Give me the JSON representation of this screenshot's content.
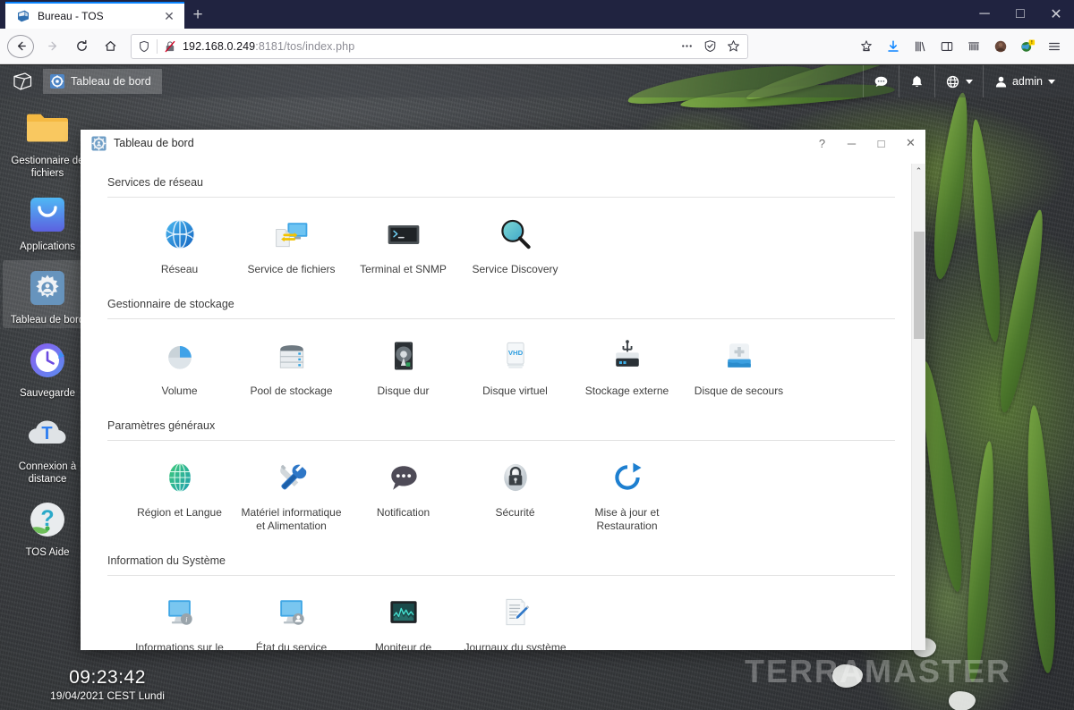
{
  "browser": {
    "tab": {
      "title": "Bureau - TOS",
      "favicon_icon": "tos-cube-icon",
      "close_icon": "close-icon"
    },
    "new_tab_label": "+",
    "nav": {
      "back_icon": "back-arrow-icon",
      "forward_icon": "forward-arrow-icon",
      "reload_icon": "reload-icon",
      "home_icon": "home-icon"
    },
    "url": {
      "shield_icon": "shield-icon",
      "insecure_icon": "insecure-lock-strikethrough-icon",
      "host": "192.168.0.249",
      "path": ":8181/tos/index.php",
      "full": "192.168.0.249:8181/tos/index.php",
      "page_actions_icon": "ellipsis-icon",
      "reader_icon": "reader-view-icon",
      "bookmark_icon": "star-icon"
    },
    "toolbar_icons": [
      "save-to-pocket-icon",
      "downloads-icon",
      "library-icon",
      "sidebars-icon",
      "containers-icon",
      "account-avatar-icon",
      "extension-globe-icon",
      "app-menu-icon"
    ],
    "extension_badge": "!",
    "window_controls": {
      "minimize": "─",
      "maximize": "□",
      "close": "✕"
    }
  },
  "tos_topbar": {
    "logo_icon": "terramaster-cube-logo-icon",
    "task_item": {
      "icon": "dashboard-gear-icon",
      "label": "Tableau de bord"
    },
    "right": [
      {
        "name": "chat-icon",
        "label": ""
      },
      {
        "name": "notification-bell-icon",
        "label": ""
      },
      {
        "name": "language-globe-icon",
        "label": ""
      }
    ],
    "user": {
      "icon": "user-icon",
      "label": "admin"
    }
  },
  "desktop": {
    "icons": [
      {
        "name": "file-manager",
        "icon": "folder-icon",
        "label": "Gestionnaire de fichiers"
      },
      {
        "name": "applications",
        "icon": "app-store-bag-icon",
        "label": "Applications"
      },
      {
        "name": "dashboard",
        "icon": "dashboard-gear-icon",
        "label": "Tableau de bord"
      },
      {
        "name": "backup",
        "icon": "clock-backup-icon",
        "label": "Sauvegarde"
      },
      {
        "name": "remote-connection",
        "icon": "cloud-t-icon",
        "label": "Connexion à distance"
      },
      {
        "name": "tos-help",
        "icon": "question-mark-icon",
        "label": "TOS Aide"
      }
    ],
    "clock": {
      "time": "09:23:42",
      "date": "19/04/2021 CEST Lundi"
    },
    "watermark": "TERRAMASTER"
  },
  "dashboard_window": {
    "title": "Tableau de bord",
    "title_icon": "dashboard-gear-icon",
    "controls": {
      "help": "?",
      "minimize": "─",
      "maximize": "□",
      "close": "✕"
    },
    "scrollbar": {
      "up_arrow": "⌃"
    },
    "sections": [
      {
        "name": "services-de-reseau",
        "heading": "Services de réseau",
        "tiles": [
          {
            "name": "reseau",
            "icon": "globe-network-icon",
            "label": "Réseau"
          },
          {
            "name": "service-de-fichiers",
            "icon": "file-service-icon",
            "label": "Service de fichiers"
          },
          {
            "name": "terminal-et-snmp",
            "icon": "terminal-icon",
            "label": "Terminal et SNMP"
          },
          {
            "name": "service-discovery",
            "icon": "magnifier-icon",
            "label": "Service Discovery"
          }
        ]
      },
      {
        "name": "gestionnaire-de-stockage",
        "heading": "Gestionnaire de stockage",
        "tiles": [
          {
            "name": "volume",
            "icon": "pie-volume-icon",
            "label": "Volume"
          },
          {
            "name": "pool-de-stockage",
            "icon": "storage-pool-icon",
            "label": "Pool de stockage"
          },
          {
            "name": "disque-dur",
            "icon": "hard-disk-icon",
            "label": "Disque dur"
          },
          {
            "name": "disque-virtuel",
            "icon": "vhd-icon",
            "label": "Disque virtuel"
          },
          {
            "name": "stockage-externe",
            "icon": "usb-storage-icon",
            "label": "Stockage externe"
          },
          {
            "name": "disque-de-secours",
            "icon": "spare-disk-icon",
            "label": "Disque de secours"
          }
        ]
      },
      {
        "name": "parametres-generaux",
        "heading": "Paramètres généraux",
        "tiles": [
          {
            "name": "region-et-langue",
            "icon": "green-globe-icon",
            "label": "Région et Langue"
          },
          {
            "name": "materiel-informatique-et-alimentation",
            "icon": "tools-icon",
            "label": "Matériel informatique et Alimentation"
          },
          {
            "name": "notification",
            "icon": "speech-bubble-icon",
            "label": "Notification"
          },
          {
            "name": "securite",
            "icon": "padlock-icon",
            "label": "Sécurité"
          },
          {
            "name": "mise-a-jour-et-restauration",
            "icon": "update-restore-icon",
            "label": "Mise à jour et Restauration"
          }
        ]
      },
      {
        "name": "information-du-systeme",
        "heading": "Information du Système",
        "tiles": [
          {
            "name": "informations-sur-le-materiel-informatique",
            "icon": "monitor-info-icon",
            "label": "Informations sur le matériel informatique"
          },
          {
            "name": "etat-du-service",
            "icon": "monitor-service-icon",
            "label": "État du service"
          },
          {
            "name": "moniteur-de-ressources",
            "icon": "resource-monitor-icon",
            "label": "Moniteur de ressources"
          },
          {
            "name": "journaux-du-systeme",
            "icon": "system-log-icon",
            "label": "Journaux du système"
          }
        ]
      }
    ]
  }
}
